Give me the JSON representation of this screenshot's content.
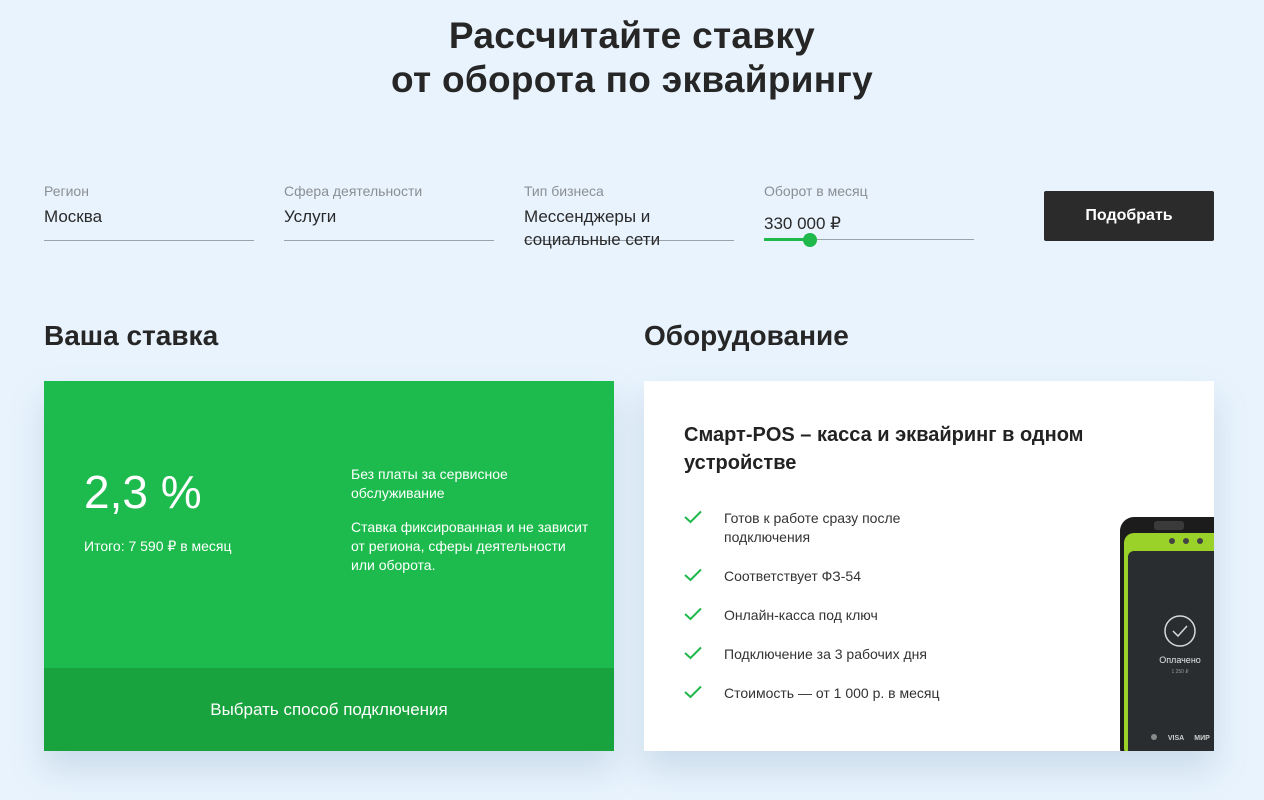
{
  "page": {
    "title_line1": "Рассчитайте ставку",
    "title_line2": "от оборота по эквайрингу"
  },
  "filters": {
    "region": {
      "label": "Регион",
      "value": "Москва"
    },
    "sphere": {
      "label": "Сфера деятельности",
      "value": "Услуги"
    },
    "business_type": {
      "label": "Тип бизнеса",
      "value": "Мессенджеры и социальные сети"
    },
    "turnover": {
      "label": "Оборот в месяц",
      "value": "330 000 ₽",
      "slider_fraction": 0.22
    },
    "submit_label": "Подобрать"
  },
  "rate": {
    "heading": "Ваша ставка",
    "value": "2,3 %",
    "total": "Итого: 7 590 ₽ в месяц",
    "note1": "Без платы за сервисное обслуживание",
    "note2": "Ставка фиксированная и не зависит от региона, сферы деятельности или оборота.",
    "action_label": "Выбрать способ подключения"
  },
  "equipment": {
    "heading": "Оборудование",
    "card_title": "Смарт-POS – касса и эквайринг в одном устройстве",
    "features": [
      "Готов к работе сразу после подключения",
      "Соответствует ФЗ-54",
      "Онлайн-касса под ключ",
      "Подключение за 3 рабочих дня",
      "Стоимость — от 1 000 р. в месяц"
    ],
    "device_screen_text": "Оплачено",
    "device_amount_text": "1 250 ₽",
    "device_brands": [
      "VISA",
      "МИР"
    ]
  },
  "colors": {
    "accent_green": "#1dbb4d",
    "accent_green_dark": "#19a33f",
    "button_dark": "#2b2b2b",
    "background": "#e8f3fd"
  }
}
